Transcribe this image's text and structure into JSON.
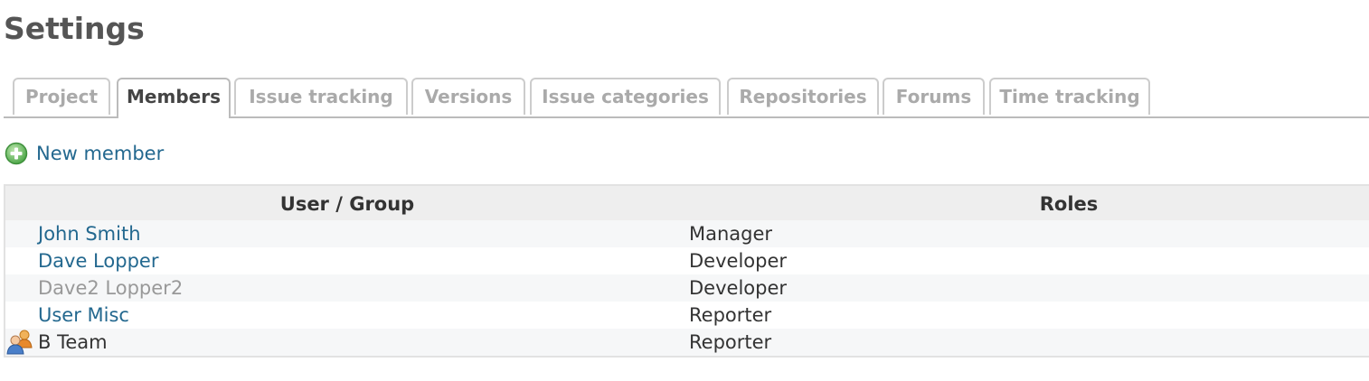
{
  "page": {
    "title": "Settings"
  },
  "tabs": [
    {
      "label": "Project",
      "selected": false
    },
    {
      "label": "Members",
      "selected": true
    },
    {
      "label": "Issue tracking",
      "selected": false
    },
    {
      "label": "Versions",
      "selected": false
    },
    {
      "label": "Issue categories",
      "selected": false
    },
    {
      "label": "Repositories",
      "selected": false
    },
    {
      "label": "Forums",
      "selected": false
    },
    {
      "label": "Time tracking",
      "selected": false
    }
  ],
  "actions": {
    "new_member_label": "New member",
    "new_member_icon": "add-icon"
  },
  "table": {
    "headers": {
      "user_group": "User / Group",
      "roles": "Roles"
    },
    "rows": [
      {
        "name": "John Smith",
        "role": "Manager",
        "type": "user",
        "locked": false
      },
      {
        "name": "Dave Lopper",
        "role": "Developer",
        "type": "user",
        "locked": false
      },
      {
        "name": "Dave2 Lopper2",
        "role": "Developer",
        "type": "user",
        "locked": true
      },
      {
        "name": "User Misc",
        "role": "Reporter",
        "type": "user",
        "locked": false
      },
      {
        "name": "B Team",
        "role": "Reporter",
        "type": "group",
        "locked": false,
        "icon": "group-icon"
      }
    ]
  },
  "colors": {
    "link": "#23688f",
    "locked_text": "#999999",
    "header_bg": "#eeeeee",
    "odd_row_bg": "#f6f7f8",
    "tab_text": "#aaaaaa",
    "tab_selected_text": "#444444",
    "title": "#555555"
  }
}
